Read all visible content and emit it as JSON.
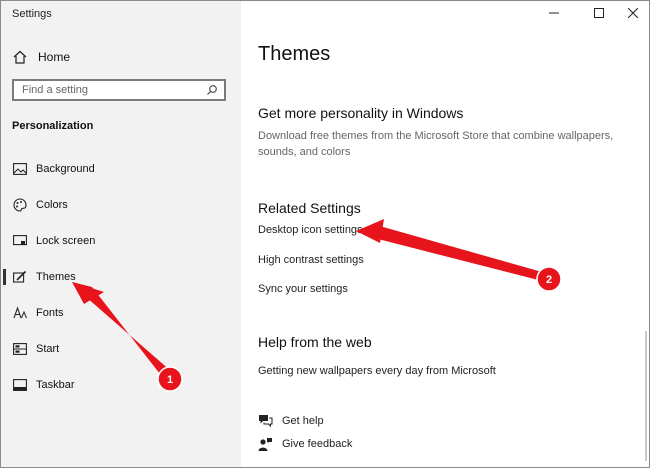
{
  "window": {
    "title": "Settings"
  },
  "sidebar": {
    "home_label": "Home",
    "search_placeholder": "Find a setting",
    "section_title": "Personalization",
    "items": [
      {
        "label": "Background",
        "icon": "picture-icon"
      },
      {
        "label": "Colors",
        "icon": "palette-icon"
      },
      {
        "label": "Lock screen",
        "icon": "lock-screen-icon"
      },
      {
        "label": "Themes",
        "icon": "brush-icon",
        "selected": true
      },
      {
        "label": "Fonts",
        "icon": "fonts-icon"
      },
      {
        "label": "Start",
        "icon": "start-icon"
      },
      {
        "label": "Taskbar",
        "icon": "taskbar-icon"
      }
    ]
  },
  "main": {
    "title": "Themes",
    "personality": {
      "heading": "Get more personality in Windows",
      "description": "Download free themes from the Microsoft Store that combine wallpapers, sounds, and colors"
    },
    "related": {
      "heading": "Related Settings",
      "links": [
        "Desktop icon settings",
        "High contrast settings",
        "Sync your settings"
      ]
    },
    "help": {
      "heading": "Help from the web",
      "link": "Getting new wallpapers every day from Microsoft",
      "get_help": "Get help",
      "give_feedback": "Give feedback"
    }
  },
  "annotations": {
    "color": "#e8141b",
    "badges": [
      "1",
      "2"
    ]
  }
}
